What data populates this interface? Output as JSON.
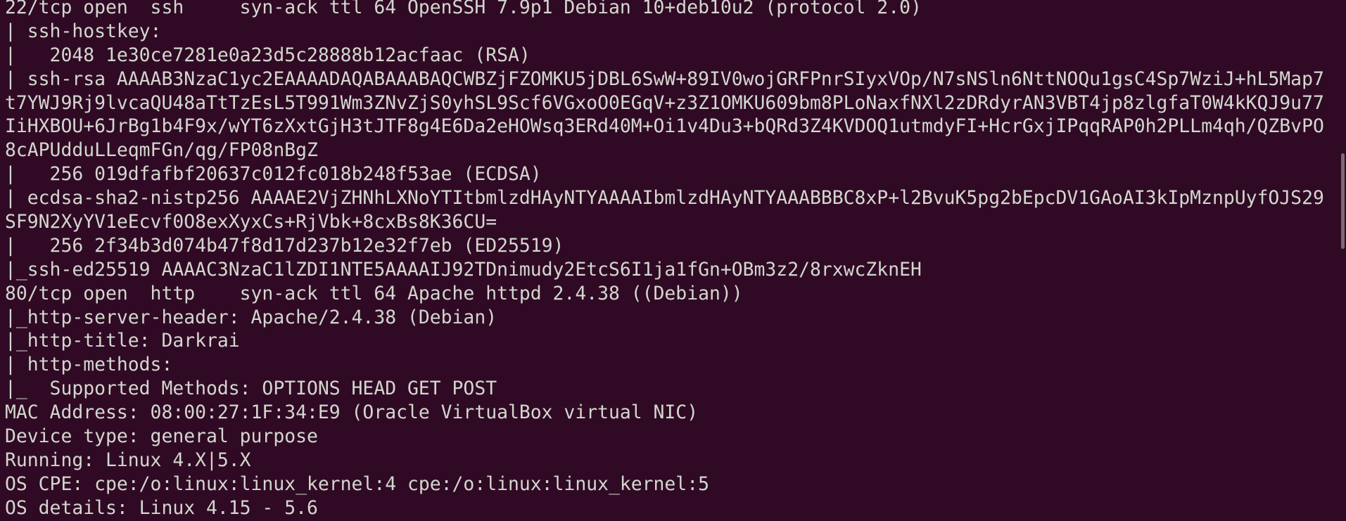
{
  "terminal": {
    "lines": [
      "22/tcp open  ssh     syn-ack ttl 64 OpenSSH 7.9p1 Debian 10+deb10u2 (protocol 2.0)",
      "| ssh-hostkey:",
      "|   2048 1e30ce7281e0a23d5c28888b12acfaac (RSA)",
      "| ssh-rsa AAAAB3NzaC1yc2EAAAADAQABAAABAQCWBZjFZOMKU5jDBL6SwW+89IV0wojGRFPnrSIyxVOp/N7sNSln6NttNOQu1gsC4Sp7WziJ+hL5Map7",
      "t7YWJ9Rj9lvcaQU48aTtTzEsL5T991Wm3ZNvZjS0yhSL9Scf6VGxoO0EGqV+z3Z1OMKU609bm8PLoNaxfNXl2zDRdyrAN3VBT4jp8zlgfaT0W4kKQJ9u77",
      "IiHXBOU+6JrBg1b4F9x/wYT6zXxtGjH3tJTF8g4E6Da2eHOWsq3ERd40M+Oi1v4Du3+bQRd3Z4KVDOQ1utmdyFI+HcrGxjIPqqRAP0h2PLLm4qh/QZBvPO",
      "8cAPUdduLLeqmFGn/qg/FP08nBgZ",
      "|   256 019dfafbf20637c012fc018b248f53ae (ECDSA)",
      "| ecdsa-sha2-nistp256 AAAAE2VjZHNhLXNoYTItbmlzdHAyNTYAAAAIbmlzdHAyNTYAAABBBC8xP+l2BvuK5pg2bEpcDV1GAoAI3kIpMznpUyfOJS29",
      "SF9N2XyYV1eEcvf0O8exXyxCs+RjVbk+8cxBs8K36CU=",
      "|   256 2f34b3d074b47f8d17d237b12e32f7eb (ED25519)",
      "|_ssh-ed25519 AAAAC3NzaC1lZDI1NTE5AAAAIJ92TDnimudy2EtcS6I1ja1fGn+OBm3z2/8rxwcZknEH",
      "80/tcp open  http    syn-ack ttl 64 Apache httpd 2.4.38 ((Debian))",
      "|_http-server-header: Apache/2.4.38 (Debian)",
      "|_http-title: Darkrai",
      "| http-methods:",
      "|_  Supported Methods: OPTIONS HEAD GET POST",
      "MAC Address: 08:00:27:1F:34:E9 (Oracle VirtualBox virtual NIC)",
      "Device type: general purpose",
      "Running: Linux 4.X|5.X",
      "OS CPE: cpe:/o:linux:linux_kernel:4 cpe:/o:linux:linux_kernel:5",
      "OS details: Linux 4.15 - 5.6"
    ]
  },
  "colors": {
    "background": "#300a24",
    "foreground": "#d3d7cf",
    "scrollbar_thumb": "#7a6a75"
  }
}
